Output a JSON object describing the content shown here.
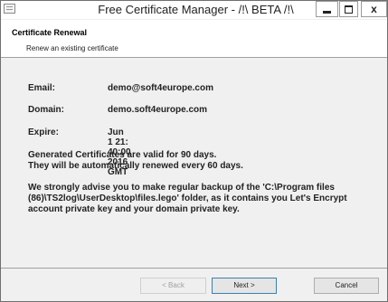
{
  "window": {
    "title": "Free Certificate Manager - /!\\ BETA /!\\",
    "controls": {
      "minimize": "",
      "maximize": "",
      "close": "x"
    }
  },
  "header": {
    "title": "Certificate Renewal",
    "subtitle": "Renew an existing certificate"
  },
  "details": [
    {
      "label": "Email:",
      "value": "demo@soft4europe.com"
    },
    {
      "label": "Domain:",
      "value": "demo.soft4europe.com"
    },
    {
      "label": "Expire:",
      "value": "Jun  1 21: 40:00 2016 GMT"
    }
  ],
  "notice": {
    "line1": "Generated Certificates are valid for 90 days.",
    "line2": "They will be automatically renewed every 60 days."
  },
  "advice": {
    "line1": "We strongly advise you to make regular backup of the 'C:\\Program files",
    "line2": "(86)\\TS2log\\UserDesktop\\files.lego' folder, as it contains you Let's Encrypt",
    "line3": "account private key and your domain private key."
  },
  "buttons": {
    "back": "< Back",
    "next": "Next >",
    "cancel": "Cancel"
  }
}
